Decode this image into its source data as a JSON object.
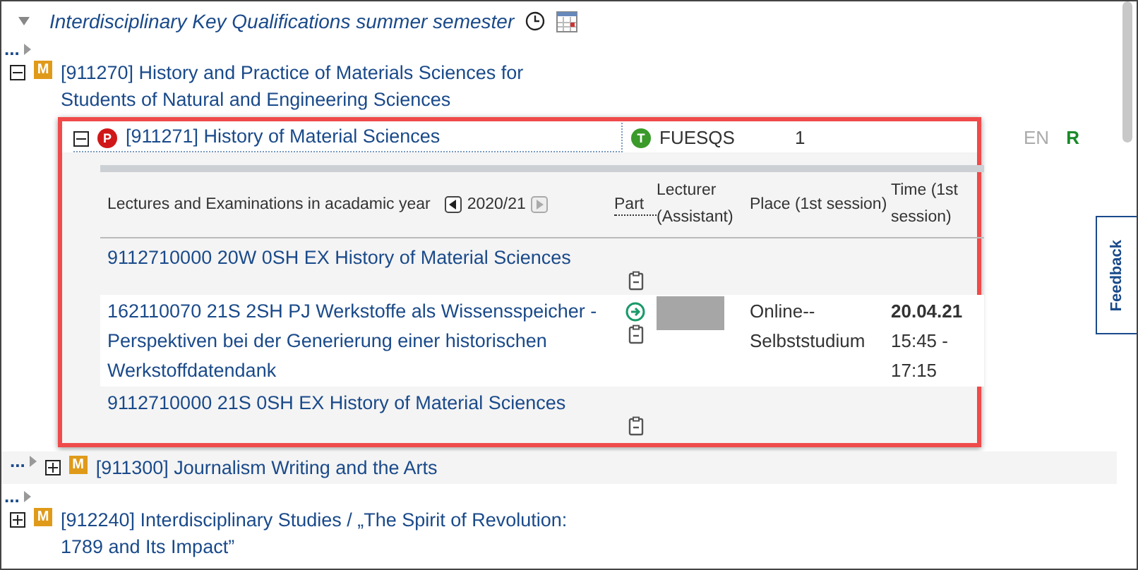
{
  "section": {
    "title": "Interdisciplinary Key Qualifications summer semester",
    "expanded": true
  },
  "modules": [
    {
      "badge": "M",
      "label": "[911270] History and Practice of Materials Sciences for Students of Natural and Engineering Sciences",
      "expanded": true,
      "ellipsis": "...",
      "ellipsis_inline": false,
      "children": [
        {
          "badge": "P",
          "label": "[911271] History of Material Sciences",
          "expanded": true,
          "status_badge": "T",
          "code": "FUESQS",
          "credits": "1",
          "language": "EN",
          "type": "R",
          "table": {
            "heading": "Lectures and Examinations in acadamic year",
            "year": "2020/21",
            "columns": [
              "Part",
              "Lecturer (Assistant)",
              "Place (1st session)",
              "Time (1st session)"
            ],
            "rows": [
              {
                "title": "9112710000 20W 0SH EX History of Material Sciences",
                "registration": false,
                "lecturer_redacted": false,
                "highlighted": false
              },
              {
                "title": "162110070 21S 2SH PJ Werkstoffe als Wissensspeicher - Perspektiven bei der Generierung einer historischen Werkstoffdatendank",
                "registration": true,
                "lecturer_redacted": true,
                "highlighted": true,
                "place": "Online--Selbststudium",
                "date": "20.04.21",
                "time": "15:45 - 17:15"
              },
              {
                "title": "9112710000 21S 0SH EX History of Material Sciences",
                "registration": false,
                "lecturer_redacted": false,
                "highlighted": false
              }
            ]
          }
        }
      ]
    },
    {
      "badge": "M",
      "label": "[911300] Journalism Writing and the Arts",
      "expanded": false,
      "ellipsis": "...",
      "ellipsis_inline": true
    },
    {
      "badge": "M",
      "label": "[912240] Interdisciplinary Studies / „The Spirit of Revolution: 1789 and Its Impact”",
      "expanded": false,
      "ellipsis": "...",
      "ellipsis_inline": false
    }
  ],
  "feedback": "Feedback"
}
